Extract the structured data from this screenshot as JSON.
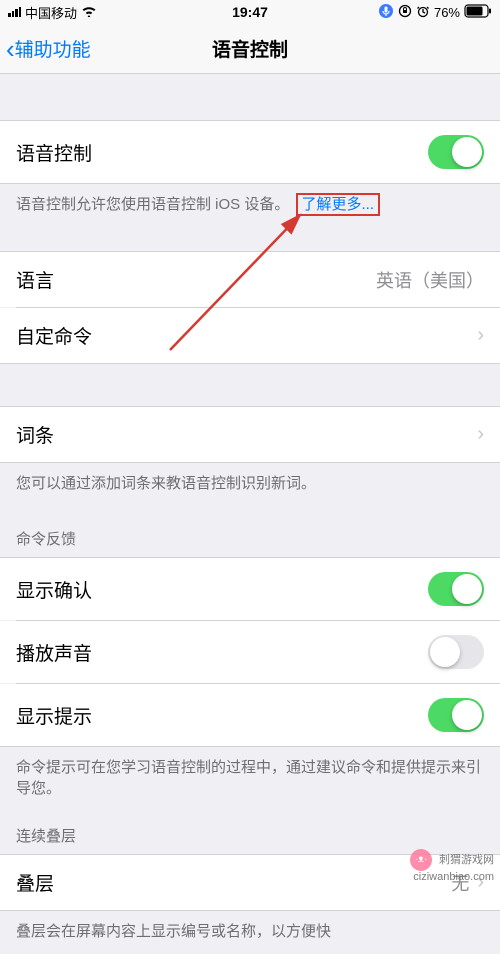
{
  "status": {
    "carrier": "中国移动",
    "time": "19:47",
    "battery_pct": "76%"
  },
  "nav": {
    "back_label": "辅助功能",
    "title": "语音控制"
  },
  "voice_control": {
    "label": "语音控制",
    "on": true,
    "desc_prefix": "语音控制允许您使用语音控制 iOS 设备。",
    "learn_more": "了解更多..."
  },
  "language": {
    "label": "语言",
    "value": "英语（美国）"
  },
  "custom_commands": {
    "label": "自定命令"
  },
  "vocabulary": {
    "label": "词条",
    "desc": "您可以通过添加词条来教语音控制识别新词。"
  },
  "feedback": {
    "header": "命令反馈",
    "show_confirm": "显示确认",
    "play_sound": "播放声音",
    "show_hints": "显示提示",
    "desc": "命令提示可在您学习语音控制的过程中，通过建议命令和提供提示来引导您。"
  },
  "overlay": {
    "header": "连续叠层",
    "label": "叠层",
    "value": "无",
    "desc": "叠层会在屏幕内容上显示编号或名称，以方便快"
  },
  "watermark": {
    "line1": "刺猬游戏网",
    "line2": "ciziwanbiao.com"
  }
}
